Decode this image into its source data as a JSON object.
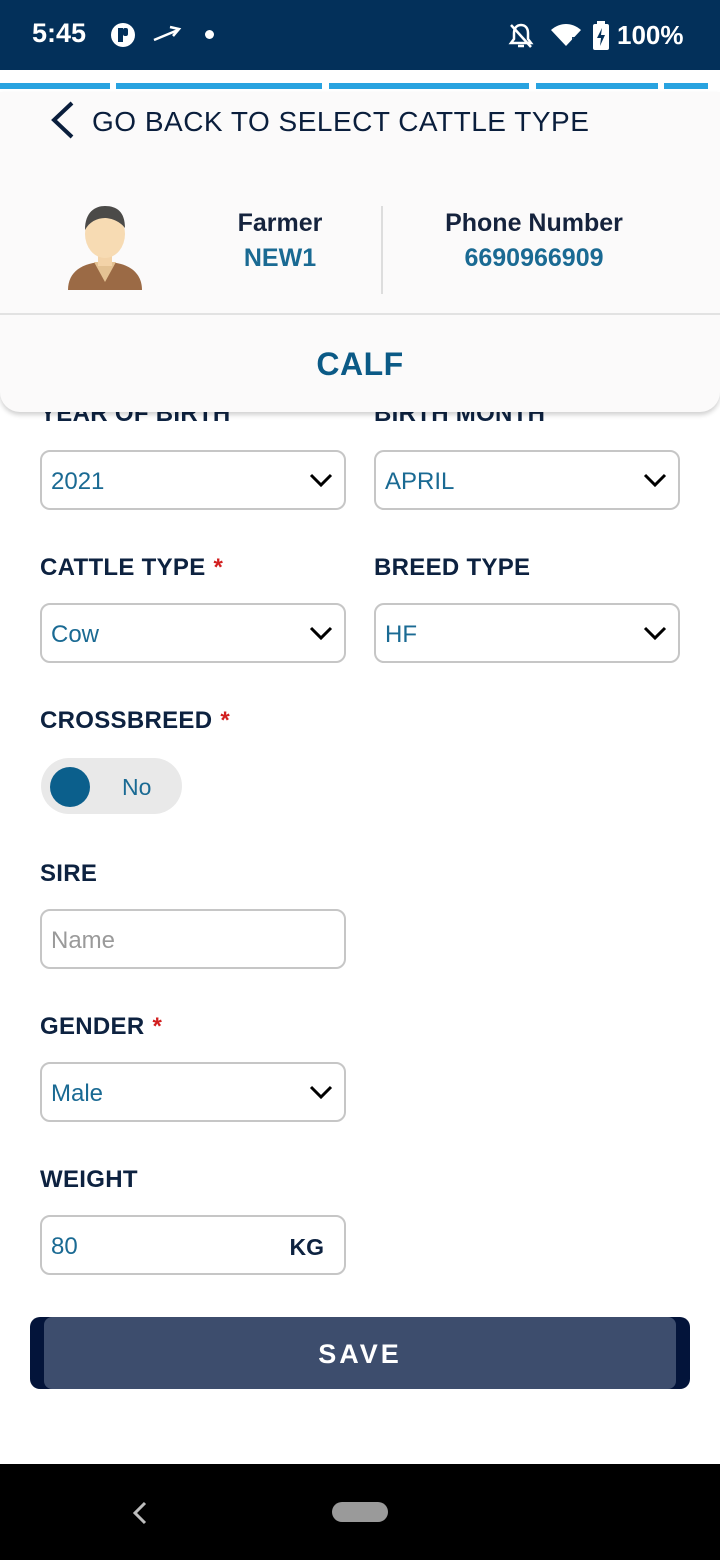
{
  "status_bar": {
    "time": "5:45",
    "battery": "100%",
    "icons": [
      "app-icon",
      "arrow-icon",
      "dot-icon",
      "bell-off-icon",
      "wifi-icon",
      "battery-charging-icon"
    ]
  },
  "header": {
    "back_label": "GO BACK TO SELECT CATTLE TYPE",
    "farmer_label": "Farmer",
    "farmer_value": "NEW1",
    "phone_label": "Phone Number",
    "phone_value": "6690966909",
    "title": "CALF"
  },
  "form": {
    "year_of_birth": {
      "label": "YEAR OF BIRTH",
      "value": "2021"
    },
    "birth_month": {
      "label": "BIRTH MONTH",
      "value": "APRIL"
    },
    "cattle_type": {
      "label": "CATTLE TYPE",
      "required": "*",
      "value": "Cow"
    },
    "breed_type": {
      "label": "BREED TYPE",
      "value": "HF"
    },
    "crossbreed": {
      "label": "CROSSBREED",
      "required": "*",
      "toggle_value": "No"
    },
    "sire": {
      "label": "SIRE",
      "placeholder": "Name"
    },
    "gender": {
      "label": "GENDER",
      "required": "*",
      "value": "Male"
    },
    "weight": {
      "label": "WEIGHT",
      "value": "80",
      "unit": "KG"
    }
  },
  "save_label": "SAVE",
  "colors": {
    "status_bar": "#03305a",
    "accent": "#0b5f8c",
    "value_text": "#1a6a93",
    "required": "#d21f1f",
    "save_button": "#3d4d6d"
  }
}
